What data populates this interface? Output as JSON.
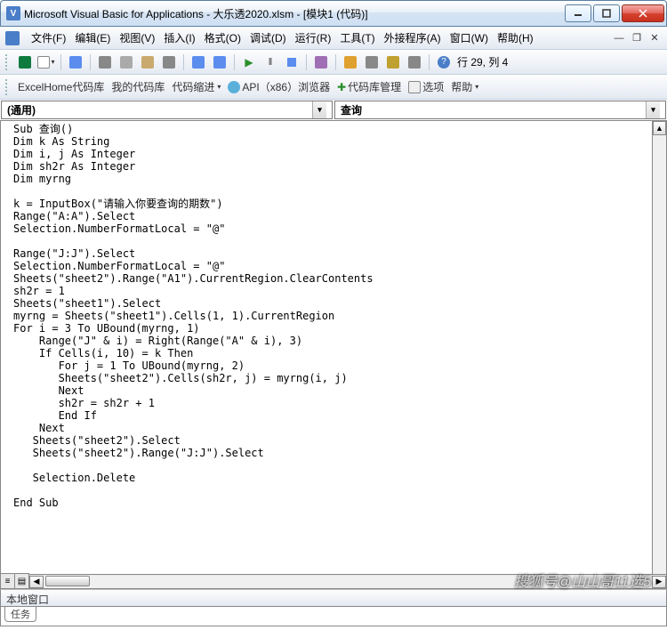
{
  "title": "Microsoft Visual Basic for Applications - 大乐透2020.xlsm - [模块1 (代码)]",
  "menus": {
    "file": "文件(F)",
    "edit": "编辑(E)",
    "view": "视图(V)",
    "insert": "插入(I)",
    "format": "格式(O)",
    "debug": "调试(D)",
    "run": "运行(R)",
    "tools": "工具(T)",
    "addins": "外接程序(A)",
    "window": "窗口(W)",
    "help": "帮助(H)"
  },
  "cursor_pos": "行 29, 列 4",
  "toolbar2": {
    "excelhome": "ExcelHome代码库",
    "mylib": "我的代码库",
    "indent": "代码缩进",
    "api": "API（x86）浏览器",
    "libmgr": "代码库管理",
    "options": "选项",
    "help": "帮助"
  },
  "object_box": "(通用)",
  "proc_box": "查询",
  "code": "Sub 查询()\nDim k As String\nDim i, j As Integer\nDim sh2r As Integer\nDim myrng\n\nk = InputBox(\"请输入你要查询的期数\")\nRange(\"A:A\").Select\nSelection.NumberFormatLocal = \"@\"\n\nRange(\"J:J\").Select\nSelection.NumberFormatLocal = \"@\"\nSheets(\"sheet2\").Range(\"A1\").CurrentRegion.ClearContents\nsh2r = 1\nSheets(\"sheet1\").Select\nmyrng = Sheets(\"sheet1\").Cells(1, 1).CurrentRegion\nFor i = 3 To UBound(myrng, 1)\n    Range(\"J\" & i) = Right(Range(\"A\" & i), 3)\n    If Cells(i, 10) = k Then\n       For j = 1 To UBound(myrng, 2)\n       Sheets(\"sheet2\").Cells(sh2r, j) = myrng(i, j)\n       Next\n       sh2r = sh2r + 1\n       End If\n    Next\n   Sheets(\"sheet2\").Select\n   Sheets(\"sheet2\").Range(\"J:J\").Select\n\n   Selection.Delete\n\nEnd Sub",
  "immediate_title": "本地窗口",
  "immediate_tab": "任务",
  "watermark": "搜狐号@山山哥11选5"
}
